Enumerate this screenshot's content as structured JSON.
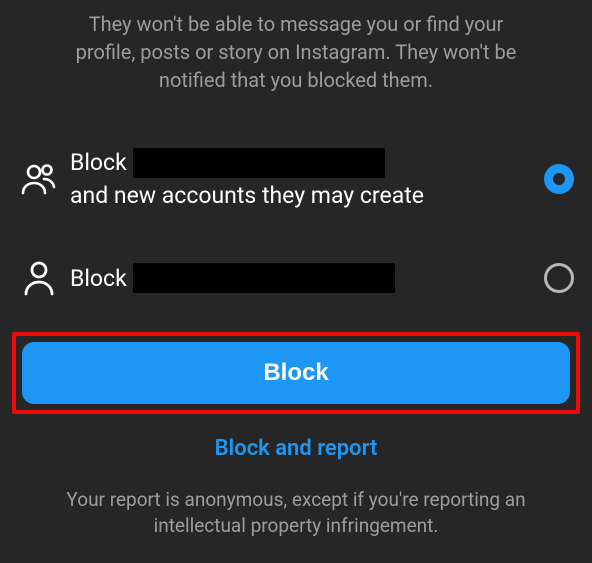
{
  "description": "They won't be able to message you or find your profile, posts or story on Instagram. They won't be notified that you blocked them.",
  "options": [
    {
      "id": "block-user-and-future",
      "prefix": "Block ",
      "suffix": " and new accounts they may create",
      "redacted": true,
      "selected": true
    },
    {
      "id": "block-user-only",
      "prefix": "Block ",
      "suffix": "",
      "redacted": true,
      "selected": false
    }
  ],
  "primary_button": "Block",
  "secondary_link": "Block and report",
  "footer": "Your report is anonymous, except if you're reporting an intellectual property infringement.",
  "highlight": "primary_button",
  "colors": {
    "accent": "#1d97f3",
    "highlight_box": "#ef0808",
    "background": "#262626",
    "muted_text": "#9d9d9d"
  }
}
